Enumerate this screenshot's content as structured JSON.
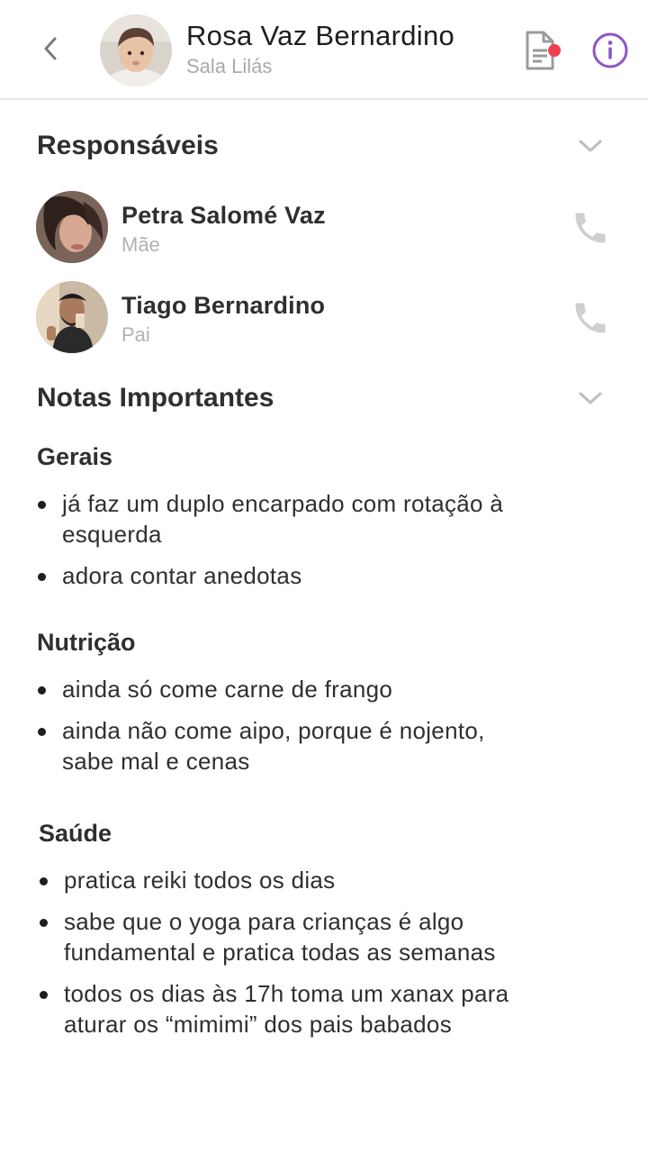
{
  "header": {
    "title": "Rosa Vaz Bernardino",
    "subtitle": "Sala Lilás",
    "back_icon": "chevron-left-icon",
    "notes_icon": "document-icon",
    "info_icon": "info-icon",
    "notification_color": "#f0404e",
    "accent_color": "#8b57c9"
  },
  "guardians": {
    "title": "Responsáveis",
    "items": [
      {
        "name": "Petra Salomé Vaz",
        "role": "Mãe"
      },
      {
        "name": "Tiago Bernardino",
        "role": "Pai"
      }
    ]
  },
  "notes": {
    "title": "Notas Importantes",
    "groups": [
      {
        "title": "Gerais",
        "items": [
          "já faz um duplo encarpado com rotação à esquerda",
          "adora contar anedotas"
        ]
      },
      {
        "title": "Nutrição",
        "items": [
          "ainda só come carne de frango",
          "ainda não come aipo, porque é nojento, sabe mal e cenas"
        ]
      },
      {
        "title": "Saúde",
        "items": [
          "pratica reiki todos os dias",
          "sabe que o yoga para crianças é algo fundamental e pratica todas as semanas",
          "todos os dias às 17h toma um xanax para aturar os “mimimi” dos pais babados"
        ]
      }
    ]
  }
}
